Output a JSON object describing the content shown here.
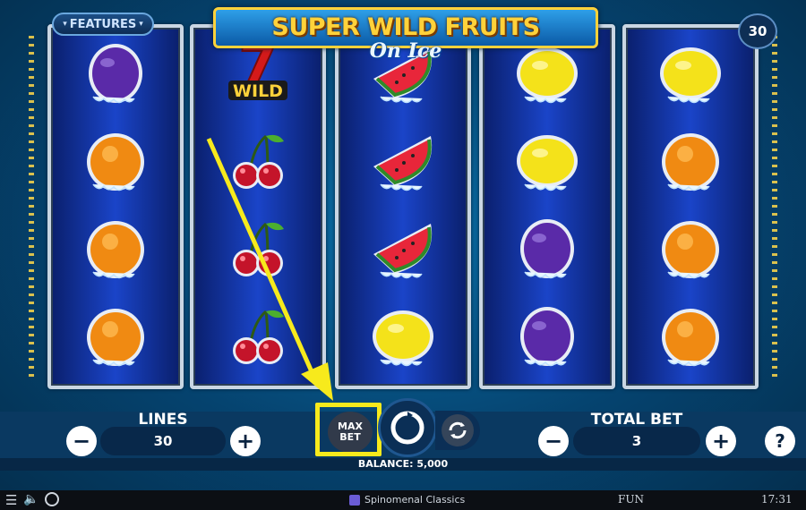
{
  "game": {
    "title": "SUPER WILD FRUITS",
    "subtitle": "On Ice",
    "features_label": "FEATURES",
    "lines_badge": "30"
  },
  "reels": [
    [
      "plum",
      "orange",
      "orange",
      "orange"
    ],
    [
      "wild",
      "cherry",
      "cherry",
      "cherry"
    ],
    [
      "watermelon",
      "watermelon",
      "watermelon",
      "lemon"
    ],
    [
      "lemon",
      "lemon",
      "plum",
      "plum"
    ],
    [
      "lemon",
      "orange",
      "orange",
      "orange"
    ]
  ],
  "symbol_labels": {
    "wild_text": "WILD",
    "wild_digit": "7"
  },
  "controls": {
    "lines_label": "LINES",
    "lines_value": "30",
    "total_bet_label": "TOTAL BET",
    "total_bet_value": "3",
    "max_bet_line1": "MAX",
    "max_bet_line2": "BET",
    "minus": "−",
    "plus": "+",
    "help": "?",
    "balance": "BALANCE: 5,000"
  },
  "status_bar": {
    "brand": "Spinomenal Classics",
    "mode": "FUN",
    "time": "17:31"
  },
  "colors": {
    "highlight": "#f7ea1c",
    "logo_gold": "#ffd23a",
    "reel_blue": "#1a44c8"
  }
}
